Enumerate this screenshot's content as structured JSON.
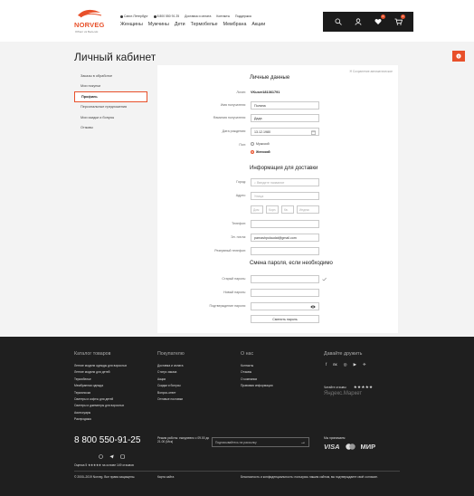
{
  "header": {
    "logo_text": "NORVEG",
    "logo_sub": "Об/ект из Бельгии",
    "top_links": [
      "Санкт-Петербург",
      "8 800 550 91 25",
      "Доставка и оплата",
      "Контакты",
      "Поддержка"
    ],
    "nav": [
      "Женщины",
      "Мужчины",
      "Дети",
      "Термобелье",
      "Мембрана",
      "Акции"
    ],
    "wishlist_count": "0",
    "cart_count": "0",
    "float_badge": "0"
  },
  "page": {
    "title": "Личный кабинет"
  },
  "sidebar": {
    "items": [
      {
        "label": "Заказы в обработке",
        "active": false
      },
      {
        "label": "Мои покупки",
        "active": false
      },
      {
        "label": "Профиль",
        "active": true
      },
      {
        "label": "Персональные предложения",
        "active": false
      },
      {
        "label": "Мои скидки и бонусы",
        "active": false
      },
      {
        "label": "Отзывы",
        "active": false
      }
    ]
  },
  "profile": {
    "save_note": "Сохранение автоматическое",
    "personal_title": "Личные данные",
    "login_label": "Логин:",
    "login_value": "VKuser181361791",
    "name_label": "Имя получателя:",
    "name_value": "Полина",
    "surname_label": "Фамилия получателя:",
    "surname_value": "Дада",
    "birthday_label": "Дата рождения:",
    "birthday_value": "13.12.1980",
    "gender_label": "Пол:",
    "gender_male": "Мужской",
    "gender_female": "Женский",
    "delivery_title": "Информация для доставки",
    "city_label": "Город:",
    "city_placeholder": "Введите название",
    "address_label": "Адрес:",
    "street_placeholder": "Улица",
    "house_placeholder": "Дом",
    "building_placeholder": "Корп.",
    "flat_placeholder": "Кв.",
    "zip_placeholder": "Индекс",
    "phone_label": "Телефон:",
    "email_label": "Эл. почта:",
    "email_value": "parnashpolaudat@gmail.com",
    "reserve_phone_label": "Резервный телефон:",
    "password_title": "Смена пароля, если необходимо",
    "old_password_label": "Старый пароль:",
    "new_password_label": "Новый пароль:",
    "confirm_password_label": "Подтверждение пароля:",
    "submit_label": "Сменить пароль"
  },
  "footer": {
    "col1_title": "Каталог товаров",
    "col1_links": [
      "Летние модели одежды для взрослых",
      "Летние модели для детей",
      "Термобелье",
      "Мембранная одежда",
      "Термоноски",
      "Свитеры и кофты для детей",
      "Свитеры и джемперы для взрослых",
      "Аксессуары",
      "Распродажа"
    ],
    "col2_title": "Покупателю",
    "col2_links": [
      "Доставка и оплата",
      "Статус заказа",
      "Акции",
      "Скидки и бонусы",
      "Вопрос-ответ",
      "Оптовые поставки"
    ],
    "col3_title": "О нас",
    "col3_links": [
      "Контакты",
      "Отзывы",
      "О компании",
      "Правовая информация"
    ],
    "col4_title": "Давайте дружить",
    "social": [
      "f",
      "вк",
      "◎",
      "▶",
      "✈"
    ],
    "rating_caption": "Читайте отзывы",
    "stars": "★★★★★",
    "yandex": "Яндекс.Маркет",
    "phone": "8 800 550-91-25",
    "hours": "Режим работы: ежедневно с 09.00 до 21.00 (Мск)",
    "subscribe_placeholder": "Подписывайтесь на рассылку",
    "pay_title": "Мы принимаем",
    "pay_visa": "VISA",
    "pay_mir": "МИР",
    "rating_text": "Оценка 5 ★★★★★ на основе 149 отзывов",
    "copyright": "© 2000–2019 Norveg. Все права защищены.",
    "sitemap": "Карта сайта",
    "privacy": "Безопасность и конфиденциальность: пользуясь нашим сайтом, вы подтверждаете своё согласие."
  }
}
